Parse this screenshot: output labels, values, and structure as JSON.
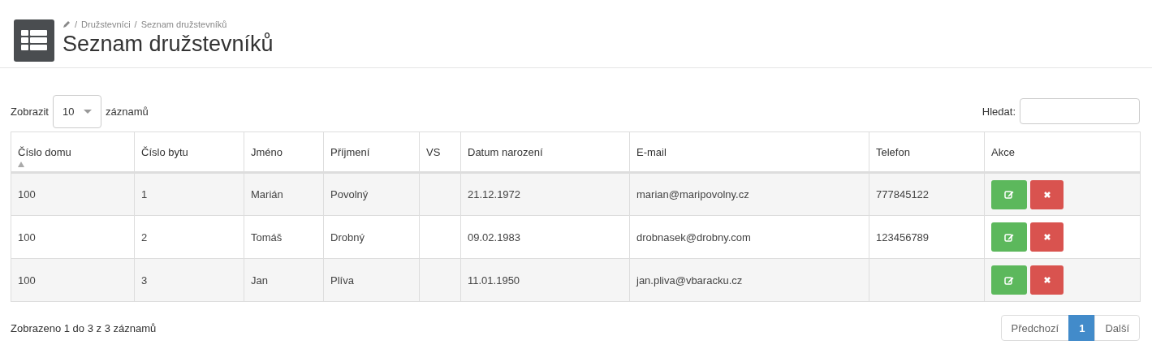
{
  "breadcrumb": {
    "separator": "/",
    "items": [
      "Družstevníci",
      "Seznam družstevníků"
    ]
  },
  "title": "Seznam družstevníků",
  "length_control": {
    "prefix": "Zobrazit",
    "value": "10",
    "suffix": "záznamů"
  },
  "search": {
    "label": "Hledat:"
  },
  "table": {
    "columns": [
      {
        "label": "Číslo domu",
        "sorted": true
      },
      {
        "label": "Číslo bytu",
        "sorted": false
      },
      {
        "label": "Jméno",
        "sorted": false
      },
      {
        "label": "Příjmení",
        "sorted": false
      },
      {
        "label": "VS",
        "sorted": false
      },
      {
        "label": "Datum narození",
        "sorted": false
      },
      {
        "label": "E-mail",
        "sorted": false
      },
      {
        "label": "Telefon",
        "sorted": false
      },
      {
        "label": "Akce",
        "sorted": false
      }
    ],
    "rows": [
      [
        "100",
        "1",
        "Marián",
        "Povolný",
        "",
        "21.12.1972",
        "marian@maripovolny.cz",
        "777845122"
      ],
      [
        "100",
        "2",
        "Tomáš",
        "Drobný",
        "",
        "09.02.1983",
        "drobnasek@drobny.com",
        "123456789"
      ],
      [
        "100",
        "3",
        "Jan",
        "Plíva",
        "",
        "11.01.1950",
        "jan.pliva@vbaracku.cz",
        ""
      ]
    ]
  },
  "info": "Zobrazeno 1 do 3 z 3 záznamů",
  "pagination": [
    {
      "label": "Předchozí",
      "selected": false
    },
    {
      "label": "1",
      "selected": true
    },
    {
      "label": "Další",
      "selected": false
    }
  ]
}
